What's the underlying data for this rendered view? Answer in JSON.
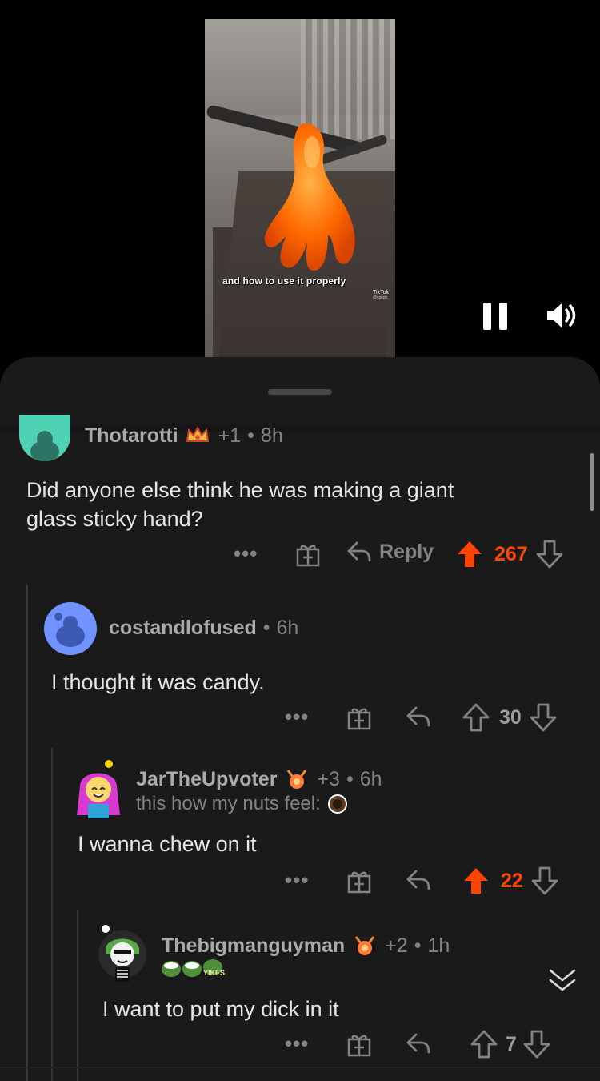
{
  "video": {
    "caption": "and how to use it properly",
    "brand": "TikTok",
    "handle": "@yokdn"
  },
  "colors": {
    "accent_upvote": "#ff4500",
    "sheet_bg": "#1a1a1b",
    "text_muted": "#818384"
  },
  "comments": [
    {
      "username": "Thotarotti",
      "karma_badge": "+1",
      "age": "8h",
      "body_line1": "Did anyone else think he was making a giant",
      "body_line2": "glass sticky hand?",
      "more": "•••",
      "reply_label": "Reply",
      "score": "267",
      "voted": "up"
    },
    {
      "username": "costandlofused",
      "age": "6h",
      "body": "I thought it was candy.",
      "more": "•••",
      "score": "30",
      "voted": "none"
    },
    {
      "username": "JarTheUpvoter",
      "karma_badge": "+3",
      "age": "6h",
      "flair": "this how my nuts feel:",
      "body": "I wanna chew on it",
      "more": "•••",
      "score": "22",
      "voted": "up"
    },
    {
      "username": "Thebigmanguyman",
      "karma_badge": "+2",
      "age": "1h",
      "flair_emoji_text": "YIKES",
      "body": "I want to put my dick in it",
      "more": "•••",
      "score": "7",
      "voted": "none"
    }
  ],
  "icons": [
    "pause-icon",
    "volume-icon",
    "gift-icon",
    "reply-arrow-icon",
    "upvote-icon",
    "downvote-icon",
    "collapse-chevron-icon"
  ]
}
